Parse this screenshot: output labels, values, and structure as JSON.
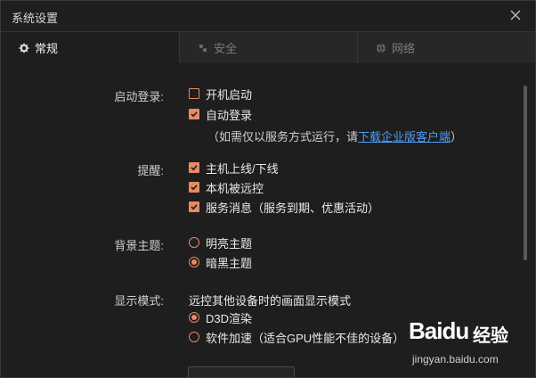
{
  "window": {
    "title": "系统设置"
  },
  "tabs": [
    {
      "label": "常规",
      "icon": "gear-icon"
    },
    {
      "label": "安全",
      "icon": "shield-icon"
    },
    {
      "label": "网络",
      "icon": "globe-icon"
    }
  ],
  "startup": {
    "label": "启动登录:",
    "options": [
      {
        "label": "开机启动",
        "checked": false
      },
      {
        "label": "自动登录",
        "checked": true
      }
    ],
    "note_prefix": "（如需仅以服务方式运行，请",
    "note_link": "下载企业版客户端",
    "note_suffix": "）"
  },
  "reminder": {
    "label": "提醒:",
    "options": [
      {
        "label": "主机上线/下线",
        "checked": true
      },
      {
        "label": "本机被远控",
        "checked": true
      },
      {
        "label": "服务消息（服务到期、优惠活动）",
        "checked": true
      }
    ]
  },
  "theme": {
    "label": "背景主题:",
    "options": [
      {
        "label": "明亮主题",
        "selected": false
      },
      {
        "label": "暗黑主题",
        "selected": true
      }
    ]
  },
  "display": {
    "label": "显示模式:",
    "description": "远控其他设备时的画面显示模式",
    "options": [
      {
        "label": "D3D渲染",
        "selected": true
      },
      {
        "label": "软件加速（适合GPU性能不佳的设备）",
        "selected": false
      }
    ]
  },
  "watermark": {
    "brand": "Baidu",
    "brand_cn": "经验",
    "url": "jingyan.baidu.com"
  },
  "colors": {
    "accent": "#e98a63",
    "link": "#4f9ef5",
    "background": "#1e1e1e"
  }
}
